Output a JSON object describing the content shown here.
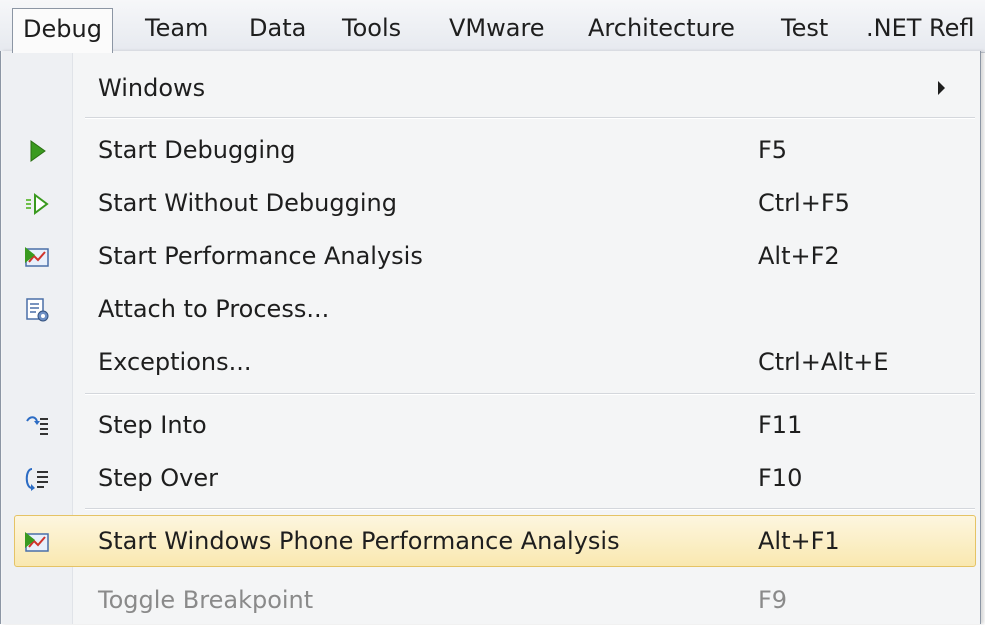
{
  "menubar": {
    "items": [
      "Debug",
      "Team",
      "Data",
      "Tools",
      "VMware",
      "Architecture",
      "Test",
      ".NET Refl"
    ]
  },
  "menu": {
    "items": [
      {
        "label": "Windows",
        "shortcut": "",
        "icon": "none",
        "submenu": true
      },
      {
        "label": "Start Debugging",
        "shortcut": "F5",
        "icon": "play-icon"
      },
      {
        "label": "Start Without Debugging",
        "shortcut": "Ctrl+F5",
        "icon": "play-outline-icon"
      },
      {
        "label": "Start Performance Analysis",
        "shortcut": "Alt+F2",
        "icon": "performance-chart-icon"
      },
      {
        "label": "Attach to Process...",
        "shortcut": "",
        "icon": "attach-process-icon"
      },
      {
        "label": "Exceptions...",
        "shortcut": "Ctrl+Alt+E",
        "icon": "none"
      },
      {
        "label": "Step Into",
        "shortcut": "F11",
        "icon": "step-into-icon"
      },
      {
        "label": "Step Over",
        "shortcut": "F10",
        "icon": "step-over-icon"
      },
      {
        "label": "Start Windows Phone Performance Analysis",
        "shortcut": "Alt+F1",
        "icon": "performance-chart-icon",
        "highlighted": true
      },
      {
        "label": "Toggle Breakpoint",
        "shortcut": "F9",
        "icon": "none",
        "disabled": true
      }
    ]
  },
  "colors": {
    "highlight_border": "#e5c365",
    "highlight_fill": "#f9e8b0",
    "play_green": "#3a9a1f",
    "disabled_text": "#8a8a8a"
  }
}
